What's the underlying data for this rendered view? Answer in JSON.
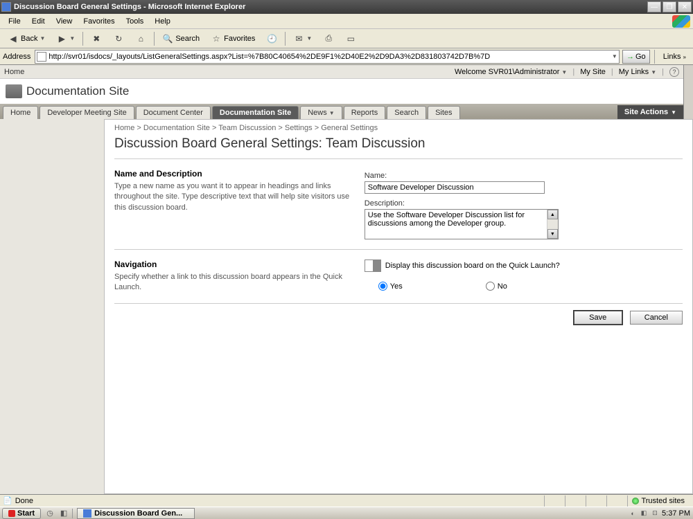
{
  "window": {
    "title": "Discussion Board General Settings - Microsoft Internet Explorer"
  },
  "menu": {
    "file": "File",
    "edit": "Edit",
    "view": "View",
    "favorites": "Favorites",
    "tools": "Tools",
    "help": "Help"
  },
  "toolbar": {
    "back": "Back",
    "search": "Search",
    "favorites": "Favorites"
  },
  "address": {
    "label": "Address",
    "url": "http://svr01/isdocs/_layouts/ListGeneralSettings.aspx?List=%7B80C40654%2DE9F1%2D40E2%2D9DA3%2D831803742D7B%7D",
    "go": "Go",
    "links": "Links"
  },
  "topnav": {
    "home": "Home",
    "welcome": "Welcome SVR01\\Administrator",
    "mysite": "My Site",
    "mylinks": "My Links"
  },
  "site": {
    "title": "Documentation Site",
    "actions": "Site Actions"
  },
  "tabs": {
    "home": "Home",
    "dev": "Developer Meeting Site",
    "doccenter": "Document Center",
    "docsite": "Documentation Site",
    "news": "News",
    "reports": "Reports",
    "search": "Search",
    "sites": "Sites"
  },
  "breadcrumb": {
    "home": "Home",
    "doc": "Documentation Site",
    "team": "Team Discussion",
    "settings": "Settings",
    "general": "General Settings"
  },
  "page": {
    "title": "Discussion Board General Settings: Team Discussion"
  },
  "section1": {
    "heading": "Name and Description",
    "desc": "Type a new name as you want it to appear in headings and links throughout the site. Type descriptive text that will help site visitors use this discussion board.",
    "name_label": "Name:",
    "name_value": "Software Developer Discussion",
    "desc_label": "Description:",
    "desc_value": "Use the Software Developer Discussion list for discussions among the Developer group."
  },
  "section2": {
    "heading": "Navigation",
    "desc": "Specify whether a link to this discussion board appears in the Quick Launch.",
    "prompt": "Display this discussion board on the Quick Launch?",
    "yes": "Yes",
    "no": "No"
  },
  "buttons": {
    "save": "Save",
    "cancel": "Cancel"
  },
  "statusbar": {
    "status": "Done",
    "zone": "Trusted sites"
  },
  "taskbar": {
    "start": "Start",
    "task": "Discussion Board Gen...",
    "time": "5:37 PM"
  }
}
